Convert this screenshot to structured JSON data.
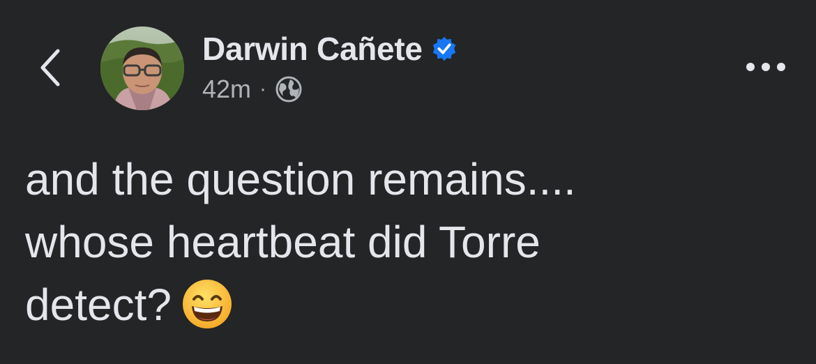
{
  "header": {
    "back_icon": "chevron-left-icon",
    "more_icon": "ellipsis-icon"
  },
  "author": {
    "name": "Darwin Cañete",
    "verified_icon": "verified-badge-icon",
    "verified_color": "#1877f2"
  },
  "meta": {
    "time": "42m",
    "separator": "·",
    "audience_icon": "globe-icon"
  },
  "post": {
    "lines": [
      "and the question remains....",
      "whose heartbeat did Torre",
      "detect?"
    ],
    "emoji_icon": "grinning-face-with-smiling-eyes-emoji"
  },
  "colors": {
    "background": "#242527",
    "primary_text": "#e4e6eb",
    "secondary_text": "#b0b3b8"
  }
}
